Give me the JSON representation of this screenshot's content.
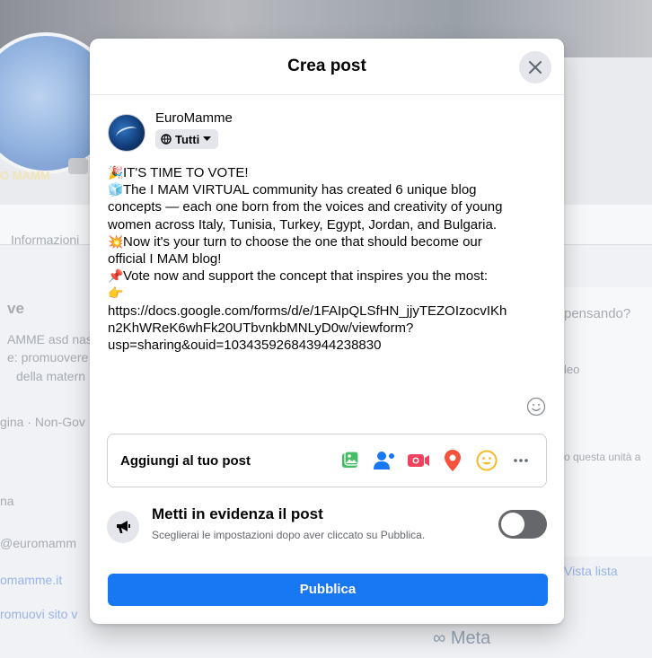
{
  "background": {
    "avatar_text": "O MAMM",
    "tab_label": "Informazioni",
    "section_heading": "ve",
    "intro_lines": [
      "AMME asd nas",
      "e: promuovere",
      "della matern"
    ],
    "category_prefix": "gina",
    "category_suffix": "· Non-Gov",
    "info_short": "na",
    "email_partial": "@euromamm",
    "website_partial": "omamme.it",
    "promote_partial": "romuovi sito v",
    "composer_placeholder": "pensando?",
    "video_label": "leo",
    "page_hint": "o questa unità a",
    "list_view": "Vista lista",
    "meta_logo": "∞ Meta"
  },
  "modal": {
    "title": "Crea post",
    "author": {
      "name": "EuroMamme",
      "audience": "Tutti"
    },
    "post_lines": [
      {
        "emoji": "🎉",
        "text": "IT'S TIME TO VOTE!"
      },
      {
        "emoji": "🧊",
        "text": "The I MAM VIRTUAL community has created 6 unique blog"
      },
      {
        "emoji": "",
        "text": "concepts — each one born from the voices and creativity of young"
      },
      {
        "emoji": "",
        "text": "women across Italy, Tunisia, Turkey, Egypt, Jordan, and Bulgaria."
      },
      {
        "emoji": "💥",
        "text": "Now it's your turn to choose the one that should become our"
      },
      {
        "emoji": "",
        "text": "official I MAM blog!"
      },
      {
        "emoji": "📌",
        "text": "Vote now and support the concept that inspires you the most:"
      },
      {
        "emoji": "👉",
        "text": ""
      },
      {
        "emoji": "",
        "text": "https://docs.google.com/forms/d/e/1FAIpQLSfHN_jjyTEZOIzocvIKh"
      },
      {
        "emoji": "",
        "text": "n2KhWReK6whFk20UTbvnkbMNLyD0w/viewform?"
      },
      {
        "emoji": "",
        "text": "usp=sharing&ouid=103435926843944238830"
      }
    ],
    "add_to_post_label": "Aggiungi al tuo post",
    "add_icons": [
      "photo-video-icon",
      "tag-people-icon",
      "live-video-icon",
      "check-in-icon",
      "feeling-icon",
      "more-icon"
    ],
    "boost": {
      "title": "Metti in evidenza il post",
      "subtitle": "Sceglierai le impostazioni dopo aver cliccato su Pubblica.",
      "enabled": false
    },
    "publish_label": "Pubblica"
  },
  "colors": {
    "primary": "#1877f2",
    "photo": "#45bd62",
    "tag": "#1877f2",
    "live": "#f3425f",
    "checkin": "#f5533d",
    "feeling": "#f7b928"
  }
}
